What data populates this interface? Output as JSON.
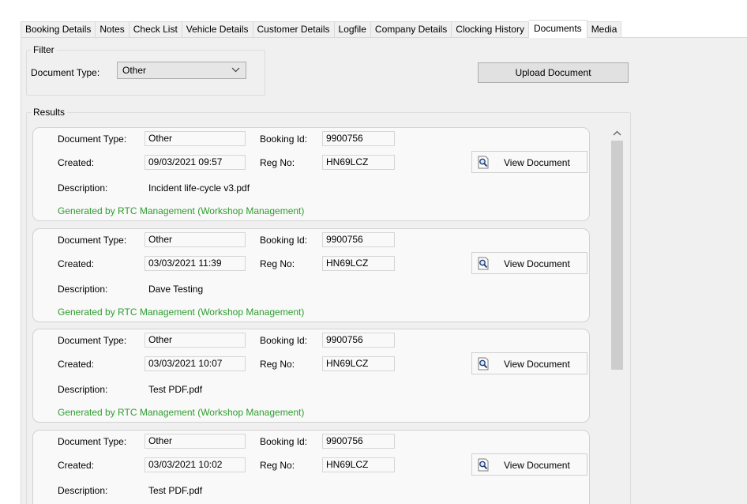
{
  "tabs": [
    {
      "label": "Booking Details",
      "active": false
    },
    {
      "label": "Notes",
      "active": false
    },
    {
      "label": "Check List",
      "active": false
    },
    {
      "label": "Vehicle Details",
      "active": false
    },
    {
      "label": "Customer Details",
      "active": false
    },
    {
      "label": "Logfile",
      "active": false
    },
    {
      "label": "Company Details",
      "active": false
    },
    {
      "label": "Clocking History",
      "active": false
    },
    {
      "label": "Documents",
      "active": true
    },
    {
      "label": "Media",
      "active": false
    }
  ],
  "filter": {
    "title": "Filter",
    "document_type_label": "Document Type:",
    "document_type_value": "Other"
  },
  "upload_button": "Upload Document",
  "results": {
    "title": "Results",
    "labels": {
      "document_type": "Document Type:",
      "booking_id": "Booking Id:",
      "created": "Created:",
      "reg_no": "Reg No:",
      "description": "Description:",
      "view_button": "View Document"
    },
    "items": [
      {
        "document_type": "Other",
        "booking_id": "9900756",
        "created": "09/03/2021 09:57",
        "reg_no": "HN69LCZ",
        "description": "Incident life-cycle v3.pdf",
        "generated_by": "Generated by RTC Management (Workshop Management)"
      },
      {
        "document_type": "Other",
        "booking_id": "9900756",
        "created": "03/03/2021 11:39",
        "reg_no": "HN69LCZ",
        "description": "Dave Testing",
        "generated_by": "Generated by RTC Management (Workshop Management)"
      },
      {
        "document_type": "Other",
        "booking_id": "9900756",
        "created": "03/03/2021 10:07",
        "reg_no": "HN69LCZ",
        "description": "Test PDF.pdf",
        "generated_by": "Generated by RTC Management (Workshop Management)"
      },
      {
        "document_type": "Other",
        "booking_id": "9900756",
        "created": "03/03/2021 10:02",
        "reg_no": "HN69LCZ",
        "description": "Test PDF.pdf",
        "generated_by": ""
      }
    ]
  },
  "icons": {
    "view_document": "magnifier-page-icon",
    "dropdown": "chevron-down-icon",
    "scroll_up": "scroll-up-arrow-icon",
    "scroll_down": "scroll-down-arrow-icon"
  }
}
